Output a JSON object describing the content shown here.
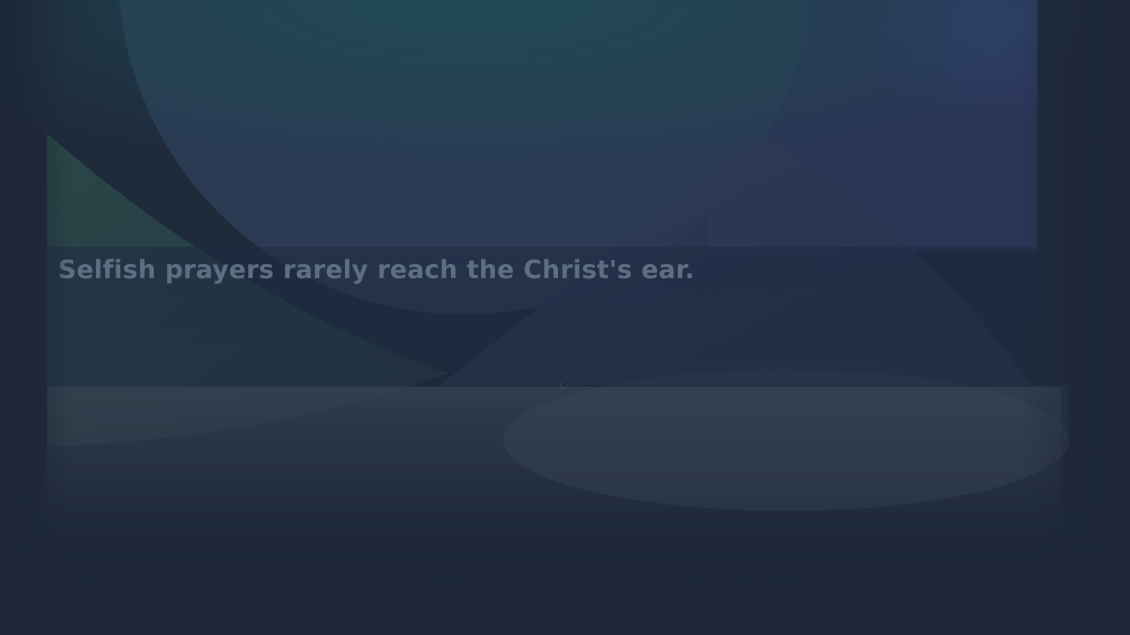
{
  "loading_screen": {
    "tip_text": "Selfish prayers rarely reach the Christ's ear.",
    "spinner_icon": "loading-spinner-icon"
  },
  "colors": {
    "background": "#1c2636",
    "text": "#5f6f83",
    "teal_glow": "#1f4550",
    "blue_glow": "#2e3e66",
    "green_shape": "#2b4548",
    "band_light": "#34404f"
  }
}
